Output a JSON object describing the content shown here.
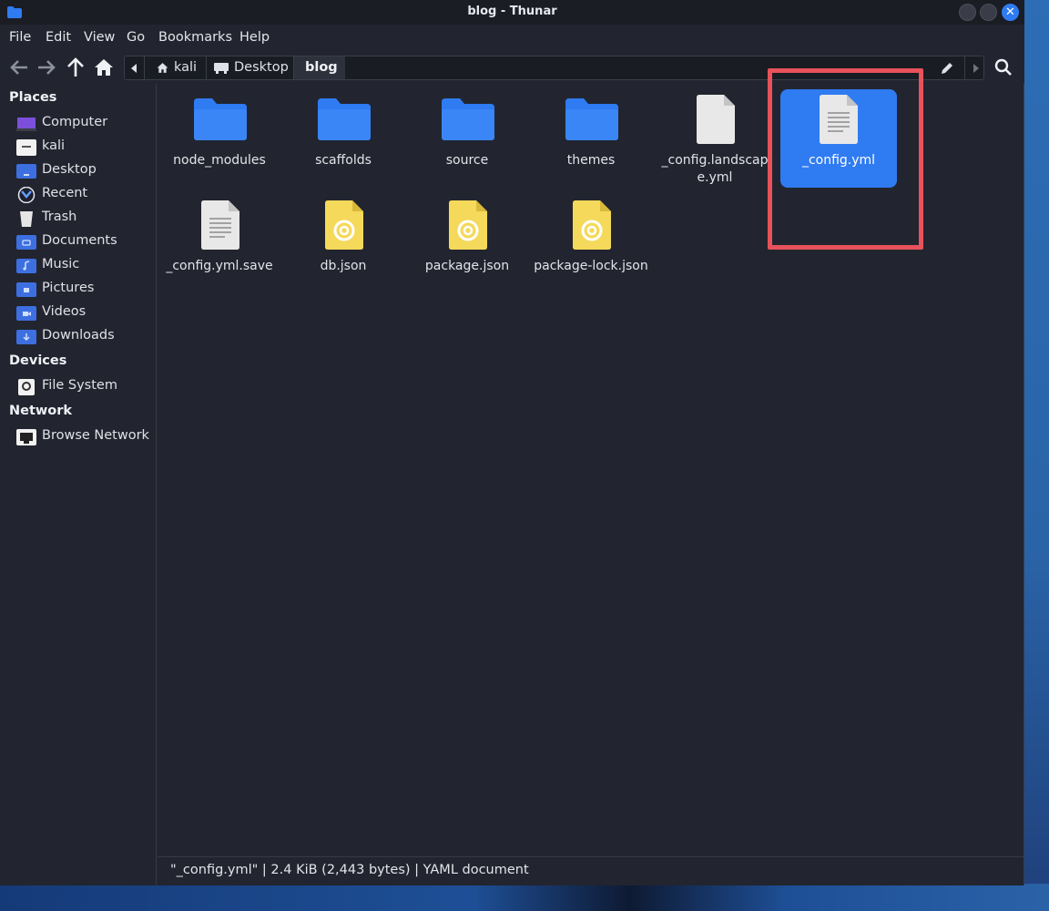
{
  "window": {
    "title": "blog - Thunar",
    "close_glyph": "✕"
  },
  "menu": [
    "File",
    "Edit",
    "View",
    "Go",
    "Bookmarks",
    "Help"
  ],
  "path": {
    "crumbs": [
      "kali",
      "Desktop",
      "blog"
    ],
    "active": "blog"
  },
  "sidebar": {
    "places_header": "Places",
    "places": [
      {
        "label": "Computer",
        "icon": "computer-icon"
      },
      {
        "label": "kali",
        "icon": "home-folder-icon"
      },
      {
        "label": "Desktop",
        "icon": "desktop-folder-icon"
      },
      {
        "label": "Recent",
        "icon": "recent-icon"
      },
      {
        "label": "Trash",
        "icon": "trash-icon"
      },
      {
        "label": "Documents",
        "icon": "documents-folder-icon"
      },
      {
        "label": "Music",
        "icon": "music-folder-icon"
      },
      {
        "label": "Pictures",
        "icon": "pictures-folder-icon"
      },
      {
        "label": "Videos",
        "icon": "videos-folder-icon"
      },
      {
        "label": "Downloads",
        "icon": "downloads-folder-icon"
      }
    ],
    "devices_header": "Devices",
    "devices": [
      {
        "label": "File System",
        "icon": "drive-icon"
      }
    ],
    "network_header": "Network",
    "network": [
      {
        "label": "Browse Network",
        "icon": "network-icon"
      }
    ]
  },
  "files": [
    {
      "name": "node_modules",
      "type": "folder"
    },
    {
      "name": "scaffolds",
      "type": "folder"
    },
    {
      "name": "source",
      "type": "folder"
    },
    {
      "name": "themes",
      "type": "folder"
    },
    {
      "name": "_config.landscape.yml",
      "type": "file-blank"
    },
    {
      "name": "_config.yml",
      "type": "text",
      "selected": true
    },
    {
      "name": "_config.yml.save",
      "type": "text"
    },
    {
      "name": "db.json",
      "type": "json"
    },
    {
      "name": "package.json",
      "type": "json"
    },
    {
      "name": "package-lock.json",
      "type": "json"
    }
  ],
  "status": {
    "text": "\"_config.yml\"  |  2.4 KiB (2,443 bytes)  |  YAML document"
  },
  "colors": {
    "accent": "#2f7bf2",
    "highlight": "#e8525a",
    "background": "#22252f"
  }
}
